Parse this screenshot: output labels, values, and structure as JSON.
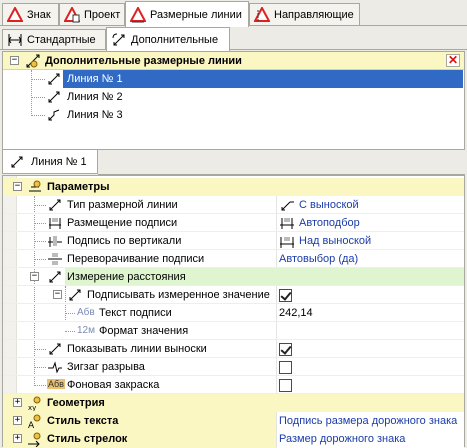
{
  "top_tabs": [
    {
      "label": "Знак",
      "active": false,
      "icon": "sign-warning-icon"
    },
    {
      "label": "Проект",
      "active": false,
      "icon": "project-icon"
    },
    {
      "label": "Размерные линии",
      "active": true,
      "icon": "dimension-lines-icon"
    },
    {
      "label": "Направляющие",
      "active": false,
      "icon": "guides-icon"
    }
  ],
  "sub_tabs": [
    {
      "label": "Стандартные",
      "active": false,
      "icon": "standard-icon"
    },
    {
      "label": "Дополнительные",
      "active": true,
      "icon": "additional-icon"
    }
  ],
  "tree": {
    "header": "Дополнительные размерные линии",
    "close_symbol": "✕",
    "items": [
      {
        "label": "Линия № 1",
        "selected": true
      },
      {
        "label": "Линия № 2",
        "selected": false
      },
      {
        "label": "Линия № 3",
        "selected": false
      }
    ]
  },
  "detail_tab": {
    "label": "Линия № 1"
  },
  "properties": {
    "params_header": "Параметры",
    "rows": {
      "type": {
        "name": "Тип размерной линии",
        "value": "С выноской"
      },
      "placement": {
        "name": "Размещение подписи",
        "value": "Автоподбор"
      },
      "vertical": {
        "name": "Подпись по вертикали",
        "value": "Над выноской"
      },
      "flip": {
        "name": "Переворачивание подписи",
        "value": "Автовыбор (да)"
      },
      "measure": {
        "name": "Измерение расстояния",
        "value": ""
      },
      "sign_measured": {
        "name": "Подписывать измеренное значение",
        "checked": true
      },
      "caption_text": {
        "name": "Текст подписи",
        "value": "242,14",
        "icon_text": "Aбв"
      },
      "value_format": {
        "name": "Формат значения",
        "value": "",
        "icon_text": "12м"
      },
      "show_ext_lines": {
        "name": "Показывать линии выноски",
        "checked": true
      },
      "zigzag": {
        "name": "Зигзаг разрыва",
        "checked": false
      },
      "bg_fill": {
        "name": "Фоновая закраска",
        "checked": false,
        "icon_text": "Aбв"
      }
    },
    "geometry_header": "Геометрия",
    "text_style": {
      "name": "Стиль текста",
      "value": "Подпись размера дорожного знака"
    },
    "arrow_style": {
      "name": "Стиль стрелок",
      "value": "Размер дорожного знака"
    }
  },
  "colors": {
    "selection": "#316ac5",
    "category_bg": "#fbf7c3",
    "highlight_bg": "#dff5cf",
    "link": "#1b3ca8"
  }
}
